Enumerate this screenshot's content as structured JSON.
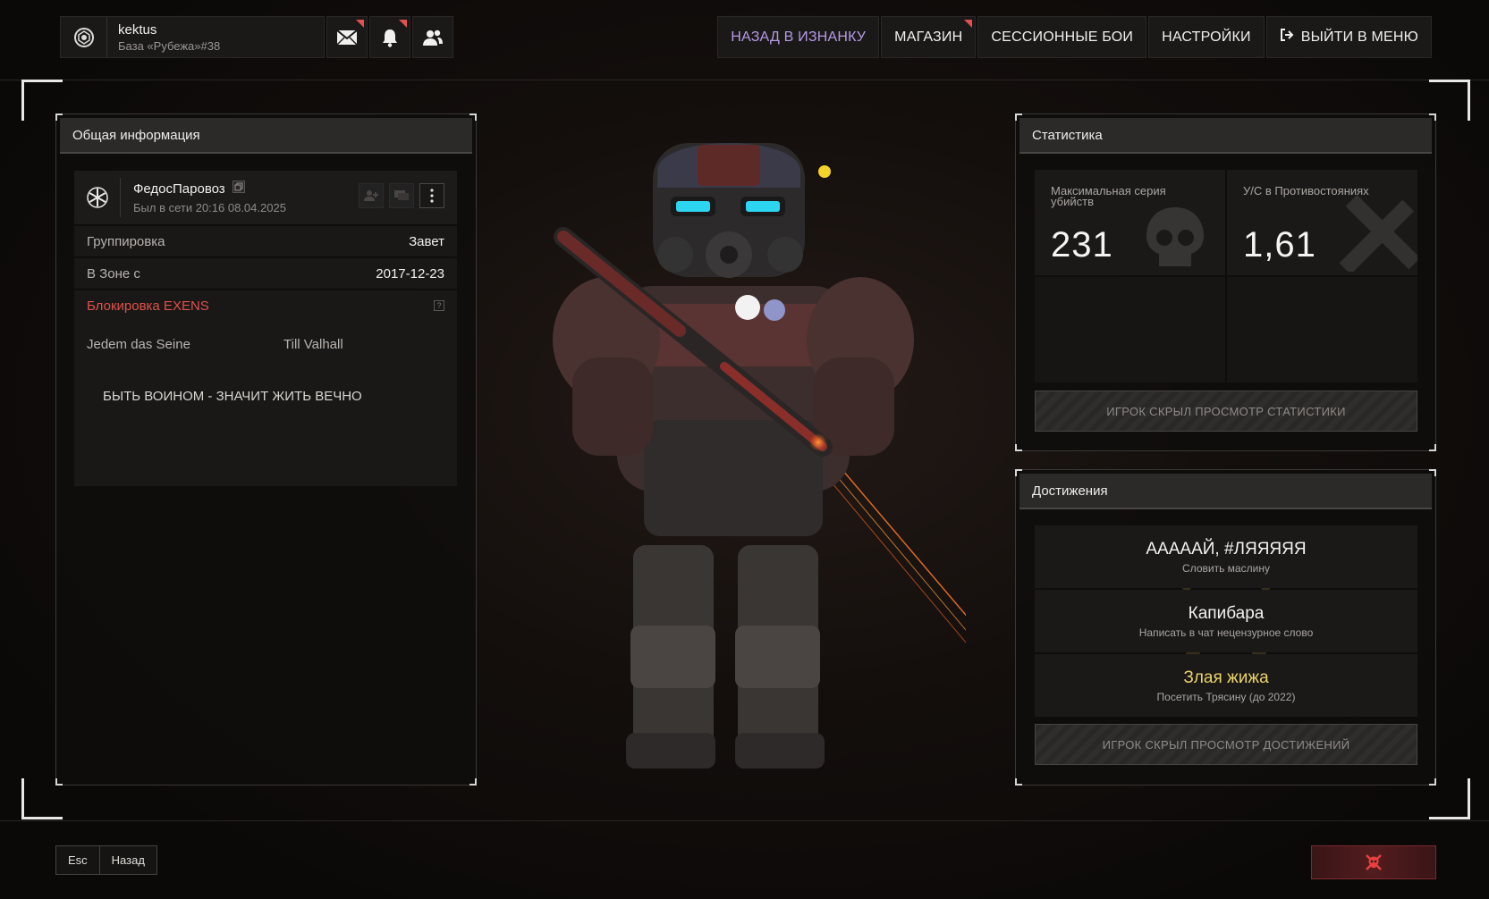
{
  "topbar": {
    "username": "kektus",
    "base": "База «Рубежа»#38",
    "mail_icon": "mail-icon",
    "bell_icon": "bell-icon",
    "friends_icon": "friends-icon"
  },
  "nav": {
    "items": [
      "НАЗАД В ИЗНАНКУ",
      "МАГАЗИН",
      "СЕССИОННЫЕ БОИ",
      "НАСТРОЙКИ",
      "ВЫЙТИ В МЕНЮ"
    ],
    "active_color": "#b79ae6"
  },
  "general": {
    "title": "Общая информация",
    "player_name": "ФедосПаровоз",
    "last_seen": "Был в сети 20:16 08.04.2025",
    "rows": [
      {
        "label": "Группировка",
        "value": "Завет"
      },
      {
        "label": "В Зоне с",
        "value": "2017-12-23"
      },
      {
        "label": "Блокировка EXENS",
        "value": "?"
      }
    ],
    "motto_left": "Jedem das Seine",
    "motto_right": "Till Valhall",
    "motto_main": "БЫТЬ ВОИНОМ - ЗНАЧИТ ЖИТЬ ВЕЧНО"
  },
  "stats": {
    "title": "Статистика",
    "cells": [
      {
        "label": "Максимальная серия убийств",
        "value": "231"
      },
      {
        "label": "У/С в Противостояниях",
        "value": "1,61"
      }
    ],
    "hidden_text": "ИГРОК СКРЫЛ ПРОСМОТР СТАТИСТИКИ"
  },
  "achievements": {
    "title": "Достижения",
    "items": [
      {
        "title": "ААААAЙ, #ЛЯЯЯЯЯ",
        "desc": "Словить маслину"
      },
      {
        "title": "Капибара",
        "desc": "Написать в чат нецензурное слово"
      },
      {
        "title": "Злая жижа",
        "desc": "Посетить Трясину (до 2022)"
      }
    ],
    "hidden_text": "ИГРОК СКРЫЛ ПРОСМОТР ДОСТИЖЕНИЙ",
    "gold_color": "#ead36a"
  },
  "bottom": {
    "esc_key": "Esc",
    "back_label": "Назад",
    "report_icon": "skull-crossbones-icon"
  }
}
